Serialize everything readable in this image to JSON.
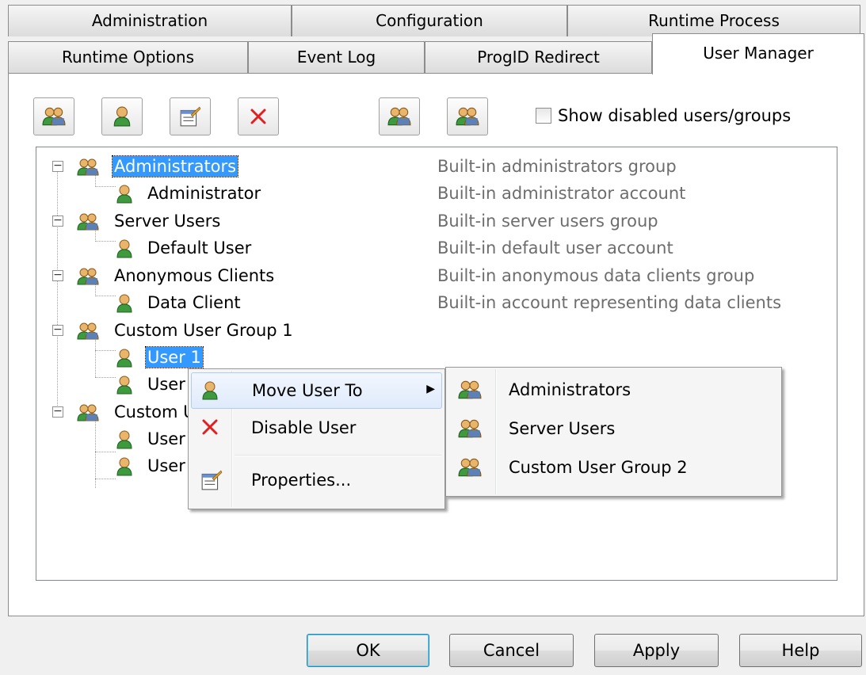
{
  "tabs_row1": [
    "Administration",
    "Configuration",
    "Runtime Process"
  ],
  "tabs_row2": [
    "Runtime Options",
    "Event Log",
    "ProgID Redirect",
    "User Manager"
  ],
  "toolbar": {
    "show_disabled_label": "Show disabled users/groups",
    "show_disabled_checked": false,
    "icons": [
      "new-group-icon",
      "new-user-icon",
      "properties-icon",
      "delete-icon",
      "import-icon",
      "export-icon"
    ]
  },
  "tree": [
    {
      "name": "Administrators",
      "desc": "Built-in administrators group"
    },
    {
      "name": "Administrator",
      "desc": "Built-in administrator account"
    },
    {
      "name": "Server Users",
      "desc": "Built-in server users group"
    },
    {
      "name": "Default User",
      "desc": "Built-in default user account"
    },
    {
      "name": "Anonymous Clients",
      "desc": "Built-in anonymous data clients group"
    },
    {
      "name": "Data Client",
      "desc": "Built-in account representing data clients"
    },
    {
      "name": "Custom User Group 1",
      "desc": ""
    },
    {
      "name": "User 1",
      "desc": ""
    },
    {
      "name": "User",
      "desc": ""
    },
    {
      "name": "Custom U",
      "desc": ""
    },
    {
      "name": "User",
      "desc": ""
    },
    {
      "name": "User",
      "desc": ""
    }
  ],
  "context_menu": {
    "items": [
      "Move User To",
      "Disable User",
      "Properties..."
    ]
  },
  "submenu": {
    "items": [
      "Administrators",
      "Server Users",
      "Custom User Group 2"
    ]
  },
  "buttons": {
    "ok": "OK",
    "cancel": "Cancel",
    "apply": "Apply",
    "help": "Help"
  }
}
